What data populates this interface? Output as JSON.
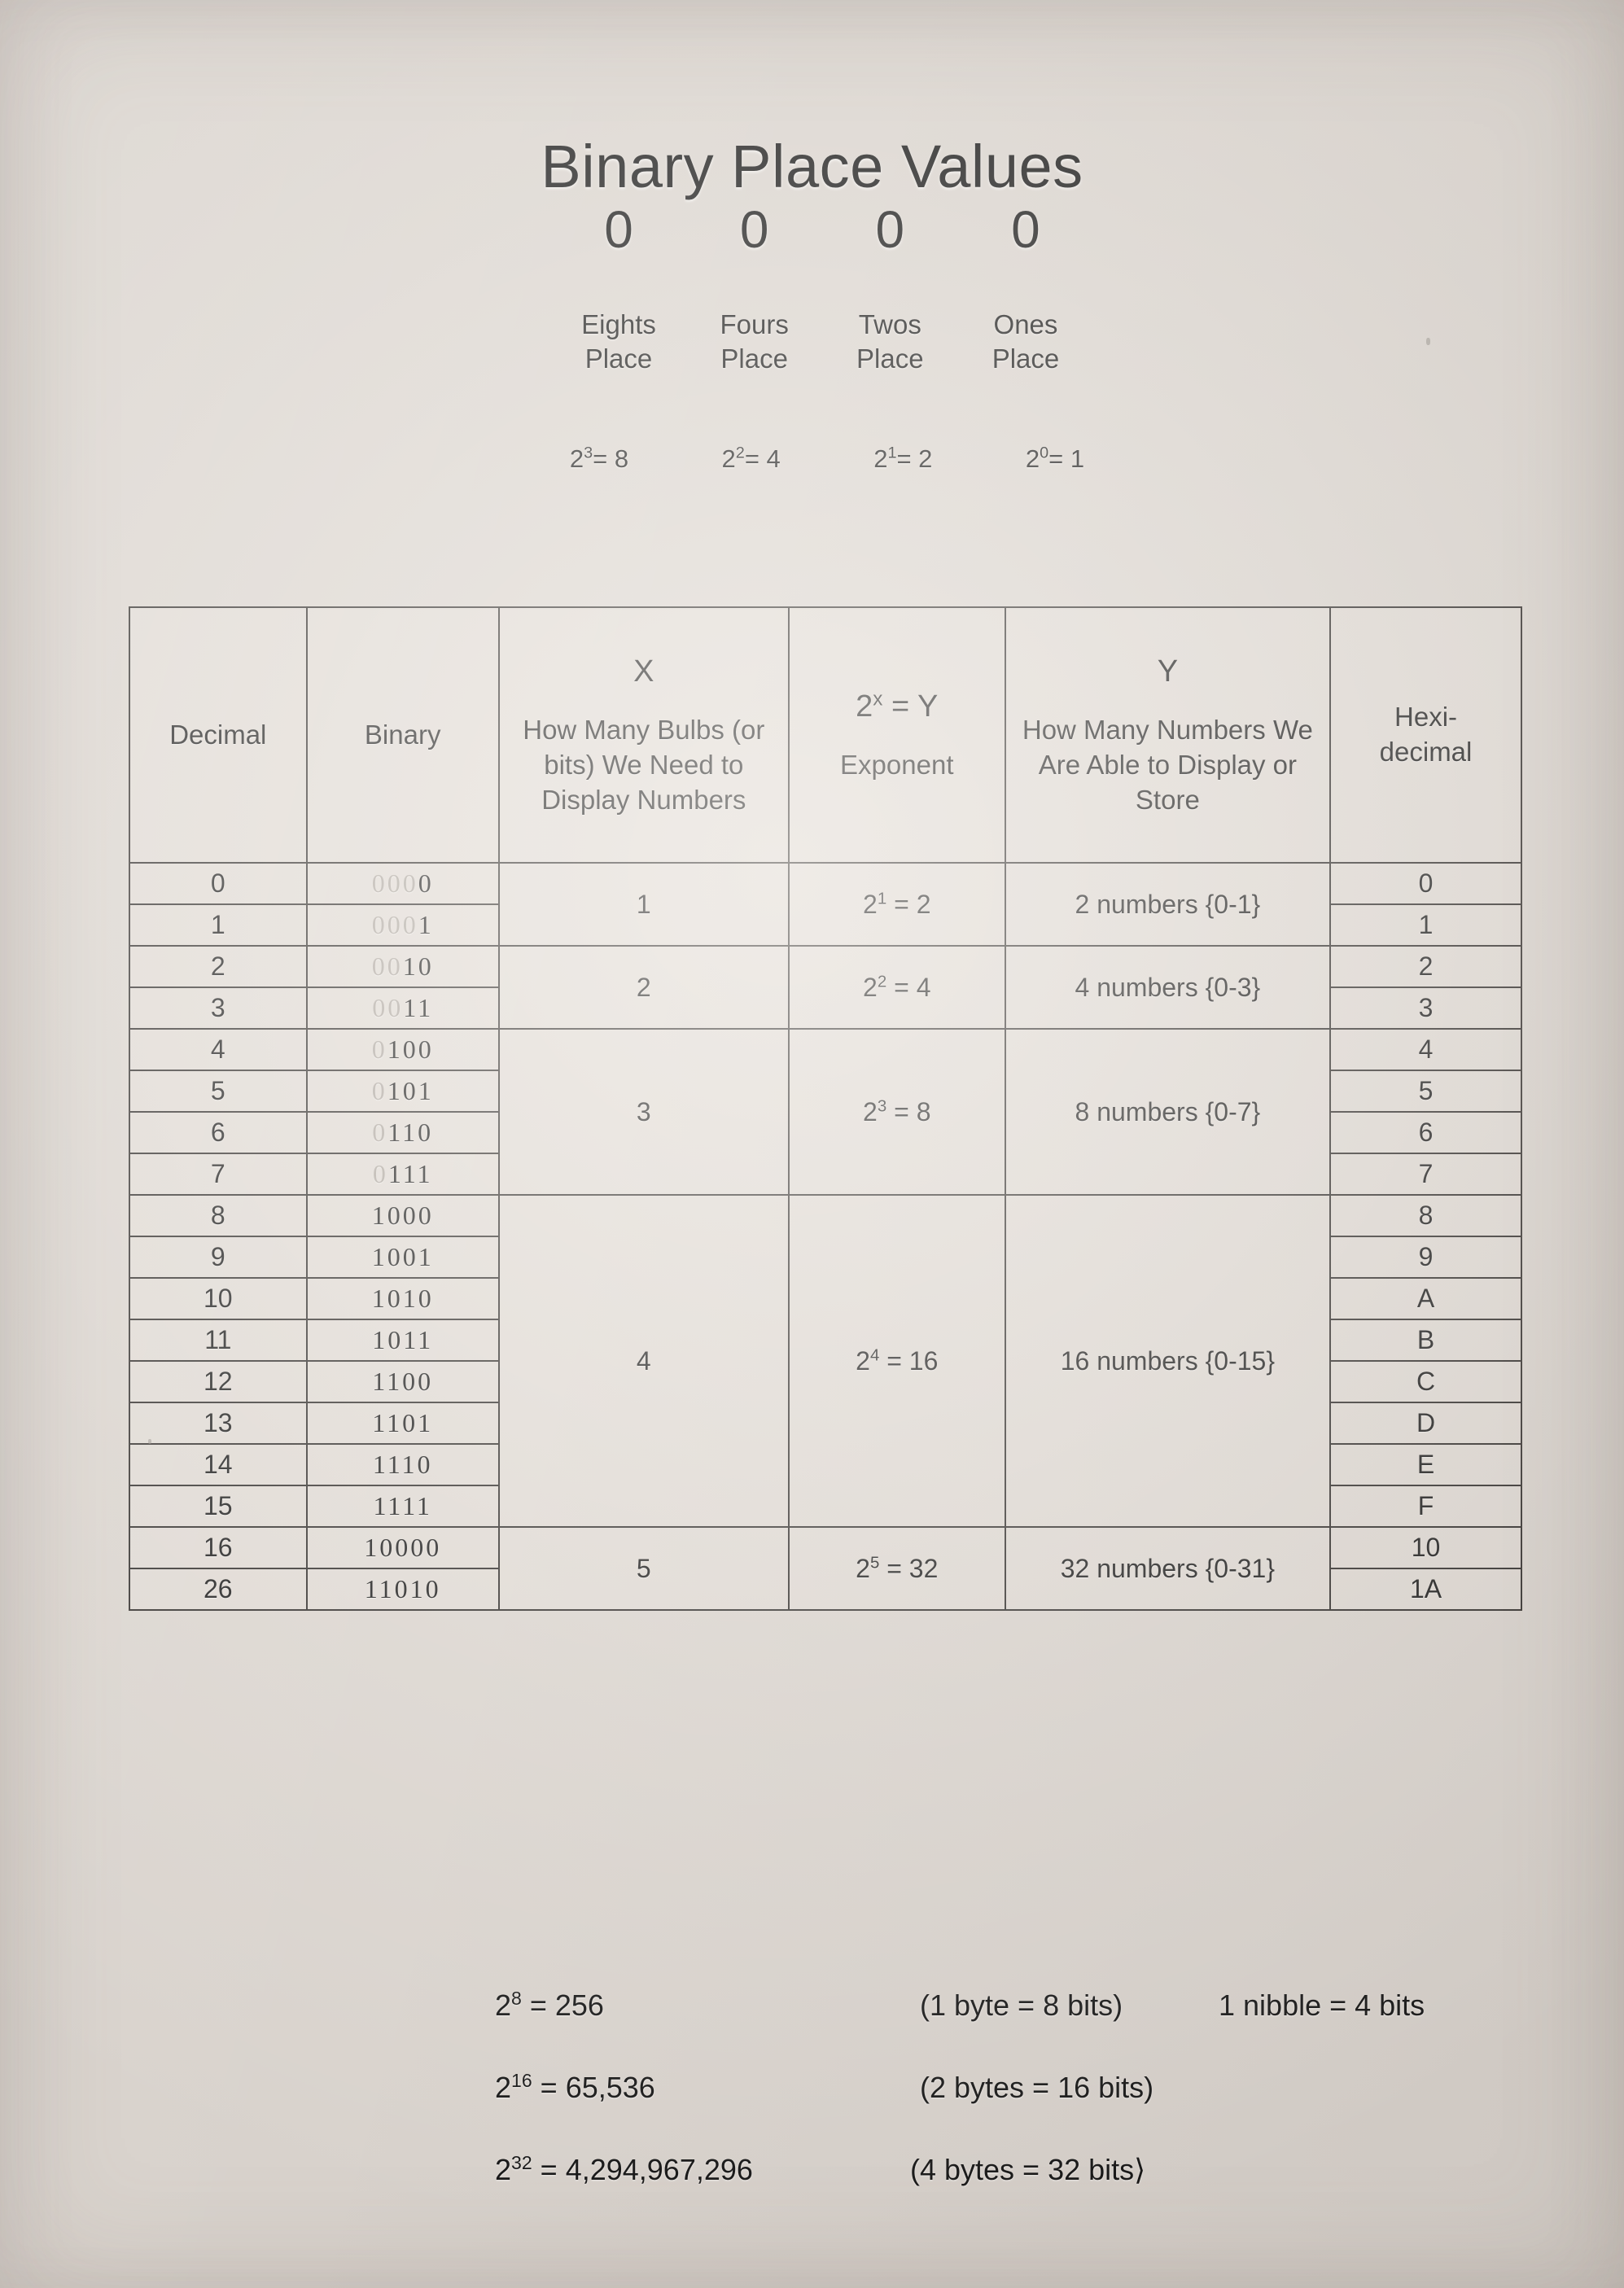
{
  "page": {
    "title": "Binary Place Values",
    "background_color": "#d8d2cc",
    "ink_color": "#141414",
    "dim_digit_color": "#aaa39c"
  },
  "nibble_display": {
    "bits": [
      "0",
      "0",
      "0",
      "0"
    ],
    "place_labels": [
      "Eights Place",
      "Fours Place",
      "Twos Place",
      "Ones Place"
    ],
    "place_labels_split": [
      {
        "word": "Eights",
        "place": "Place"
      },
      {
        "word": "Fours",
        "place": "Place"
      },
      {
        "word": "Twos",
        "place": "Place"
      },
      {
        "word": "Ones",
        "place": "Place"
      }
    ],
    "powers": [
      {
        "base": "2",
        "exp": "3",
        "eq": "= 8"
      },
      {
        "base": "2",
        "exp": "2",
        "eq": "= 4"
      },
      {
        "base": "2",
        "exp": "1",
        "eq": "= 2"
      },
      {
        "base": "2",
        "exp": "0",
        "eq": "= 1"
      }
    ]
  },
  "table": {
    "headers": {
      "decimal": "Decimal",
      "binary": "Binary",
      "bulbs_top": "X",
      "bulbs_sub": "How Many Bulbs (or bits) We Need to Display Numbers",
      "exponent_top": "2ˣ = Y",
      "exponent_sub": "Exponent",
      "numbers_top": "Y",
      "numbers_sub": "How Many Numbers We Are Able to Display or Store",
      "hex": "Hexi-decimal",
      "hex_line1": "Hexi-",
      "hex_line2": "decimal"
    },
    "rows": [
      {
        "decimal": "0",
        "binary_dim": "000",
        "binary_lit": "0",
        "hex": "0"
      },
      {
        "decimal": "1",
        "binary_dim": "000",
        "binary_lit": "1",
        "hex": "1"
      },
      {
        "decimal": "2",
        "binary_dim": "00",
        "binary_lit": "10",
        "hex": "2"
      },
      {
        "decimal": "3",
        "binary_dim": "00",
        "binary_lit": "11",
        "hex": "3"
      },
      {
        "decimal": "4",
        "binary_dim": "0",
        "binary_lit": "100",
        "hex": "4"
      },
      {
        "decimal": "5",
        "binary_dim": "0",
        "binary_lit": "101",
        "hex": "5"
      },
      {
        "decimal": "6",
        "binary_dim": "0",
        "binary_lit": "110",
        "hex": "6"
      },
      {
        "decimal": "7",
        "binary_dim": "0",
        "binary_lit": "111",
        "hex": "7"
      },
      {
        "decimal": "8",
        "binary_dim": "",
        "binary_lit": "1000",
        "hex": "8"
      },
      {
        "decimal": "9",
        "binary_dim": "",
        "binary_lit": "1001",
        "hex": "9"
      },
      {
        "decimal": "10",
        "binary_dim": "",
        "binary_lit": "1010",
        "hex": "A"
      },
      {
        "decimal": "11",
        "binary_dim": "",
        "binary_lit": "1011",
        "hex": "B"
      },
      {
        "decimal": "12",
        "binary_dim": "",
        "binary_lit": "1100",
        "hex": "C"
      },
      {
        "decimal": "13",
        "binary_dim": "",
        "binary_lit": "1101",
        "hex": "D"
      },
      {
        "decimal": "14",
        "binary_dim": "",
        "binary_lit": "1110",
        "hex": "E"
      },
      {
        "decimal": "15",
        "binary_dim": "",
        "binary_lit": "1111",
        "hex": "F"
      },
      {
        "decimal": "16",
        "binary_dim": "",
        "binary_lit": "10000",
        "hex": "10"
      },
      {
        "decimal": "26",
        "binary_dim": "",
        "binary_lit": "11010",
        "hex": "1A"
      }
    ],
    "groups": [
      {
        "bulbs": "1",
        "exponent_base": "2",
        "exponent_exp": "1",
        "exponent_val": "= 2",
        "numbers": "2 numbers {0-1}",
        "span": 2
      },
      {
        "bulbs": "2",
        "exponent_base": "2",
        "exponent_exp": "2",
        "exponent_val": "= 4",
        "numbers": "4 numbers {0-3}",
        "span": 2
      },
      {
        "bulbs": "3",
        "exponent_base": "2",
        "exponent_exp": "3",
        "exponent_val": "= 8",
        "numbers": "8 numbers {0-7}",
        "span": 4
      },
      {
        "bulbs": "4",
        "exponent_base": "2",
        "exponent_exp": "4",
        "exponent_val": "= 16",
        "numbers": "16 numbers {0-15}",
        "span": 8
      },
      {
        "bulbs": "5",
        "exponent_base": "2",
        "exponent_exp": "5",
        "exponent_val": "= 32",
        "numbers": "32 numbers {0-31}",
        "span": 2
      }
    ]
  },
  "footer": {
    "lines": [
      {
        "left_base": "2",
        "left_exp": "8",
        "left_val": "=  256",
        "right": "(1 byte  = 8 bits)",
        "extra": "1 nibble = 4 bits"
      },
      {
        "left_base": "2",
        "left_exp": "16",
        "left_val": "=  65,536",
        "right": "(2 bytes  = 16 bits)",
        "extra": ""
      },
      {
        "left_base": "2",
        "left_exp": "32",
        "left_val": "=  4,294,967,296",
        "right": "(4 bytes  = 32 bits⟩",
        "extra": ""
      }
    ]
  }
}
